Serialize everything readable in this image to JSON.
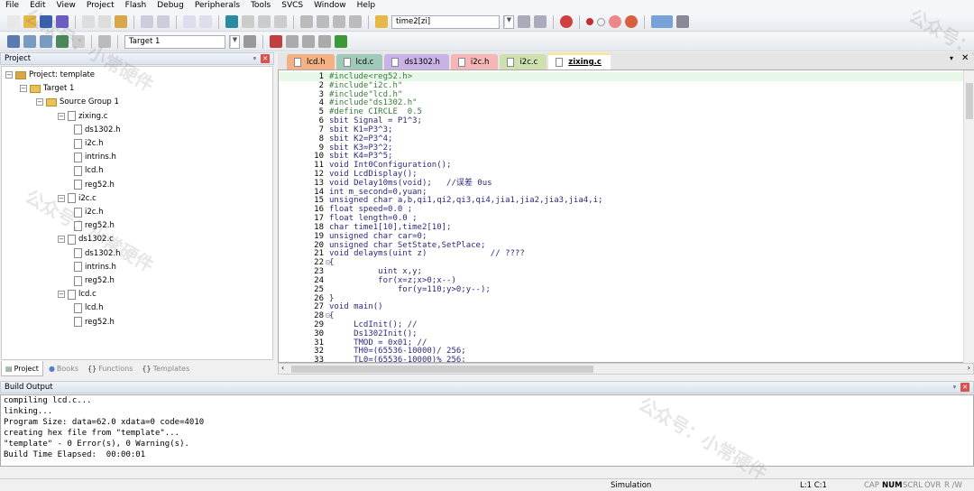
{
  "menu": [
    "File",
    "Edit",
    "View",
    "Project",
    "Flash",
    "Debug",
    "Peripherals",
    "Tools",
    "SVCS",
    "Window",
    "Help"
  ],
  "toolbar": {
    "find_combo": "time2[zi]",
    "target_combo": "Target 1"
  },
  "project_panel": {
    "title": "Project",
    "tree": [
      {
        "label": "Project: template",
        "level": 0,
        "type": "project"
      },
      {
        "label": "Target 1",
        "level": 1,
        "type": "target"
      },
      {
        "label": "Source Group 1",
        "level": 2,
        "type": "folder"
      },
      {
        "label": "zixing.c",
        "level": 3,
        "type": "cfile"
      },
      {
        "label": "ds1302.h",
        "level": 4,
        "type": "hfile"
      },
      {
        "label": "i2c.h",
        "level": 4,
        "type": "hfile"
      },
      {
        "label": "intrins.h",
        "level": 4,
        "type": "hfile"
      },
      {
        "label": "lcd.h",
        "level": 4,
        "type": "hfile"
      },
      {
        "label": "reg52.h",
        "level": 4,
        "type": "hfile"
      },
      {
        "label": "i2c.c",
        "level": 3,
        "type": "cfile"
      },
      {
        "label": "i2c.h",
        "level": 4,
        "type": "hfile"
      },
      {
        "label": "reg52.h",
        "level": 4,
        "type": "hfile"
      },
      {
        "label": "ds1302.c",
        "level": 3,
        "type": "cfile"
      },
      {
        "label": "ds1302.h",
        "level": 4,
        "type": "hfile"
      },
      {
        "label": "intrins.h",
        "level": 4,
        "type": "hfile"
      },
      {
        "label": "reg52.h",
        "level": 4,
        "type": "hfile"
      },
      {
        "label": "lcd.c",
        "level": 3,
        "type": "cfile"
      },
      {
        "label": "lcd.h",
        "level": 4,
        "type": "hfile"
      },
      {
        "label": "reg52.h",
        "level": 4,
        "type": "hfile"
      }
    ],
    "tabs": [
      {
        "label": "Project",
        "active": true
      },
      {
        "label": "Books"
      },
      {
        "label": "Functions"
      },
      {
        "label": "Templates"
      }
    ]
  },
  "editor": {
    "tabs": [
      {
        "label": "lcd.h",
        "color": "#f4b183"
      },
      {
        "label": "lcd.c",
        "color": "#9fc9b8"
      },
      {
        "label": "ds1302.h",
        "color": "#c9b3e6"
      },
      {
        "label": "i2c.h",
        "color": "#f4b6b6"
      },
      {
        "label": "i2c.c",
        "color": "#cfe0b0"
      },
      {
        "label": "zixing.c",
        "color": "#fbe6a0",
        "active": true
      }
    ],
    "lines": [
      "#include<reg52.h>",
      "#include\"i2c.h\"",
      "#include\"lcd.h\"",
      "#include\"ds1302.h\"",
      "#define CIRCLE  0.5",
      "sbit Signal = P1^3;",
      "sbit K1=P3^3;",
      "sbit K2=P3^4;",
      "sbit K3=P3^2;",
      "sbit K4=P3^5;",
      "void Int0Configuration();",
      "void LcdDisplay();",
      "void Delay10ms(void);   //误差 0us",
      "int m_second=0,yuan;",
      "unsigned char a,b,qi1,qi2,qi3,qi4,jia1,jia2,jia3,jia4,i;",
      "float speed=0.0 ;",
      "float length=0.0 ;",
      "char time1[10],time2[10];",
      "unsigned char car=0;",
      "unsigned char SetState,SetPlace;",
      "void delayms(uint z)             // ????",
      "{",
      "          uint x,y;",
      "          for(x=z;x>0;x--)",
      "              for(y=110;y>0;y--);",
      "}",
      "void main()",
      "{",
      "     LcdInit(); //",
      "     Ds1302Init();",
      "     TMOD = 0x01; //",
      "     TH0=(65536-10000)/ 256;",
      "     TL0=(65536-10000)% 256;"
    ]
  },
  "build_output": {
    "title": "Build Output",
    "lines": [
      "compiling lcd.c...",
      "linking...",
      "Program Size: data=62.0 xdata=0 code=4010",
      "creating hex file from \"template\"...",
      "\"template\" - 0 Error(s), 0 Warning(s).",
      "Build Time Elapsed:  00:00:01"
    ]
  },
  "status": {
    "mode": "Simulation",
    "position": "L:1 C:1",
    "cap": "CAP",
    "num": "NUM",
    "scrl": "SCRL",
    "ovr": "OVR",
    "rw": "R /W"
  },
  "watermark": "公众号：小常硬件"
}
